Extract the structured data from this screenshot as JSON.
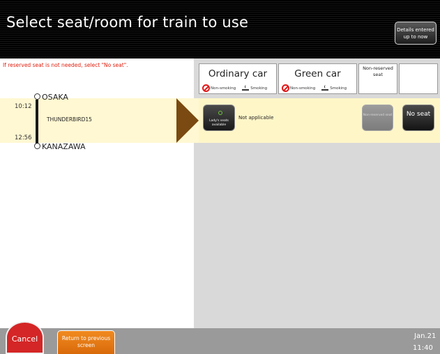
{
  "header": {
    "title": "Select seat/room for train to use",
    "details_button": "Details entered up to now"
  },
  "notice": "If reserved seat is not needed, select \"No seat\".",
  "columns": {
    "ordinary": {
      "title": "Ordinary car",
      "non_smoking": "Non-smoking",
      "smoking": "Smoking"
    },
    "green": {
      "title": "Green car",
      "non_smoking": "Non-smoking",
      "smoking": "Smoking"
    },
    "non_reserved": {
      "title": "Non-reserved seat"
    }
  },
  "train": {
    "origin": "OSAKA",
    "destination": "KANAZAWA",
    "departure_time": "10:12",
    "arrival_time": "12:56",
    "name": "THUNDERBIRD15",
    "ladies_button": "Lady's seats available",
    "not_applicable": "Not applicable",
    "nonreserved_button": "Non-reserved seat",
    "noseat_button": "No seat"
  },
  "footer": {
    "cancel": "Cancel",
    "return": "Return to previous screen",
    "date": "Jan.21",
    "time": "11:40"
  },
  "colors": {
    "header_bg": "#000000",
    "notice_text": "#e02010",
    "row_highlight": "#fff8d2",
    "arrow": "#7a4a12",
    "cancel": "#d42626",
    "return": "#f08a20",
    "panel_bg": "#d9d9d9"
  }
}
